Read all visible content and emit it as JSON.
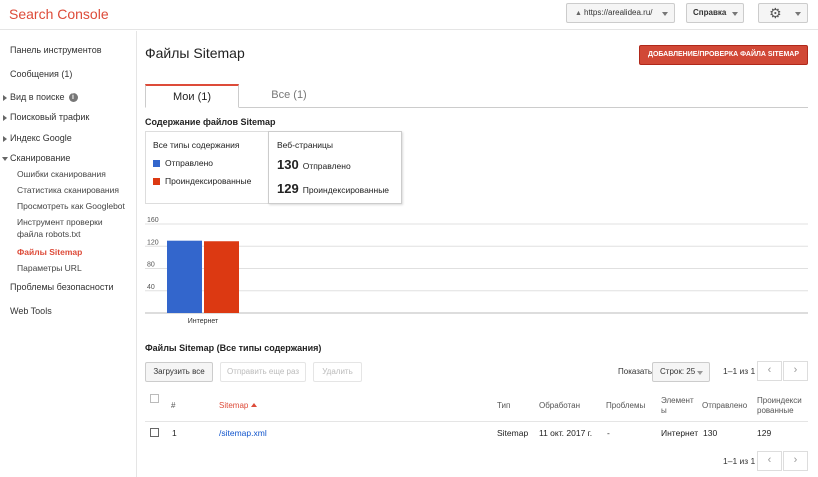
{
  "app": {
    "title": "Search Console"
  },
  "topbar": {
    "site": "https://arealidea.ru/",
    "help_label": "Справка"
  },
  "sidebar": {
    "items": [
      {
        "label": "Панель инструментов"
      },
      {
        "label": "Сообщения (1)"
      },
      {
        "label": "Вид в поиске"
      },
      {
        "label": "Поисковый трафик"
      },
      {
        "label": "Индекс Google"
      },
      {
        "label": "Сканирование"
      },
      {
        "label": "Проблемы безопасности"
      },
      {
        "label": "Web Tools"
      }
    ],
    "crawl_sub": [
      {
        "label": "Ошибки сканирования"
      },
      {
        "label": "Статистика сканирования"
      },
      {
        "label": "Просмотреть как Googlebot"
      },
      {
        "label": "Инструмент проверки"
      },
      {
        "label": "файла robots.txt"
      },
      {
        "label": "Файлы Sitemap"
      },
      {
        "label": "Параметры URL"
      }
    ]
  },
  "main": {
    "title": "Файлы Sitemap",
    "add_button": "ДОБАВЛЕНИЕ/ПРОВЕРКА ФАЙЛА SITEMAP",
    "tabs": [
      {
        "label": "Мои (1)"
      },
      {
        "label": "Все (1)"
      }
    ],
    "content_title": "Содержание файлов Sitemap",
    "legend": {
      "head": "Все типы содержания",
      "submitted": "Отправлено",
      "indexed": "Проиндексированные"
    },
    "stats": {
      "head": "Веб-страницы",
      "submitted_value": "130",
      "submitted_label": "Отправлено",
      "indexed_value": "129",
      "indexed_label": "Проиндексированные"
    },
    "files_title": "Файлы Sitemap (Все типы содержания)",
    "buttons": {
      "load_all": "Загрузить все",
      "resubmit": "Отправить еще раз",
      "delete": "Удалить"
    },
    "show_label": "Показать",
    "rows_select": "Строк: 25",
    "pager_text": "1–1 из 1",
    "table": {
      "headers": {
        "num": "#",
        "sitemap": "Sitemap",
        "type": "Тип",
        "processed": "Обработан",
        "issues": "Проблемы",
        "items_1": "Элемент",
        "items_2": "ы",
        "submitted": "Отправлено",
        "indexed_1": "Проиндекси",
        "indexed_2": "рованные"
      },
      "rows": [
        {
          "num": "1",
          "sitemap": "/sitemap.xml",
          "type": "Sitemap",
          "processed": "11 окт. 2017 г.",
          "issues": "-",
          "items": "Интернет",
          "submitted": "130",
          "indexed": "129"
        }
      ]
    }
  },
  "colors": {
    "accent": "#dd4b39",
    "submitted": "#3366cc",
    "indexed": "#dc3912",
    "link": "#1155cc"
  },
  "chart_data": {
    "type": "bar",
    "categories": [
      "Интернет"
    ],
    "series": [
      {
        "name": "Отправлено",
        "values": [
          130
        ]
      },
      {
        "name": "Проиндексированные",
        "values": [
          129
        ]
      }
    ],
    "y_ticks": [
      40,
      80,
      120,
      160
    ],
    "ylim": [
      0,
      160
    ],
    "grid": true
  }
}
